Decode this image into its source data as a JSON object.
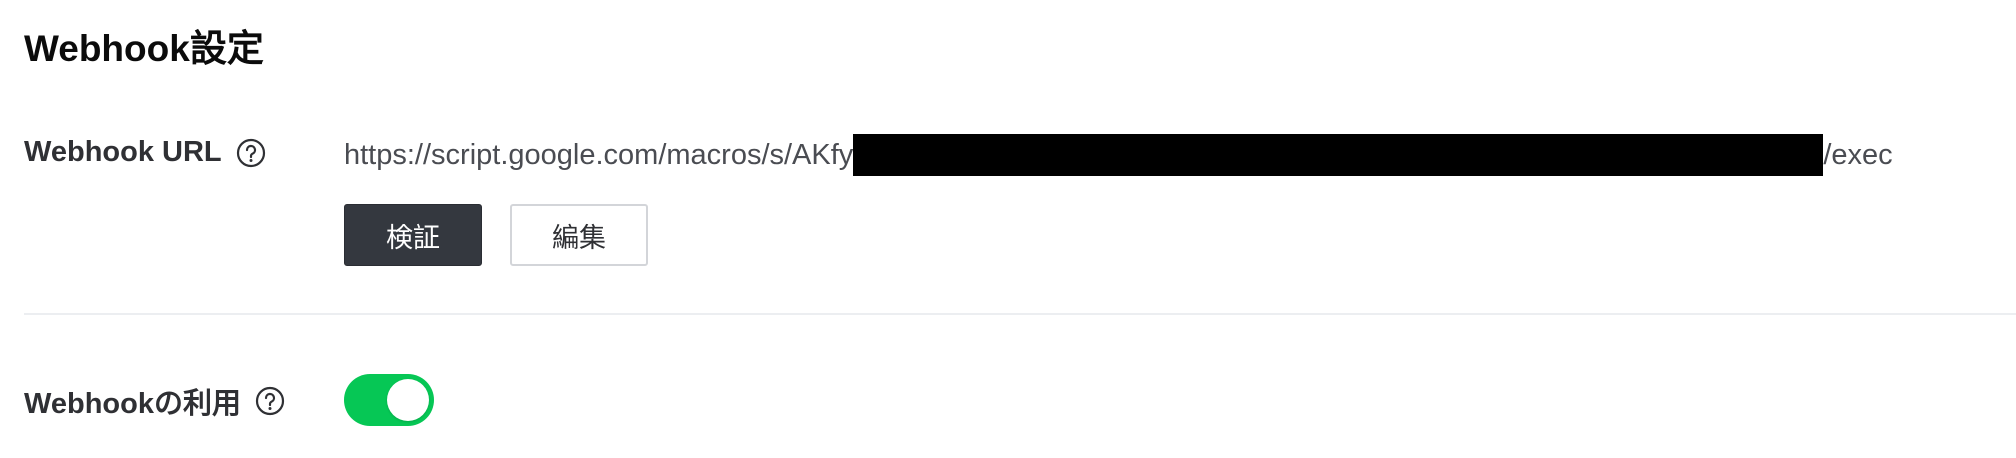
{
  "section": {
    "title": "Webhook設定"
  },
  "webhook_url": {
    "label": "Webhook URL",
    "help_icon": "question-circle-icon",
    "url_prefix": "https://script.google.com/macros/s/AKfy",
    "url_suffix": "/exec",
    "verify_label": "検証",
    "edit_label": "編集"
  },
  "use_webhook": {
    "label": "Webhookの利用",
    "help_icon": "question-circle-icon",
    "enabled": true
  },
  "colors": {
    "toggle_on": "#06c755",
    "primary_button": "#34383f",
    "label_text": "#2f3034",
    "url_text": "#4a4c52",
    "divider": "#eceef1"
  }
}
